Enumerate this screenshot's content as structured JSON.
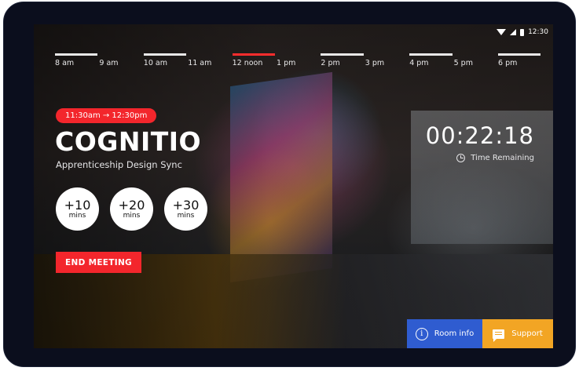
{
  "status_bar": {
    "time": "12:30"
  },
  "timeline": {
    "labels": [
      "8 am",
      "9 am",
      "10 am",
      "11 am",
      "12 noon",
      "1 pm",
      "2 pm",
      "3 pm",
      "4 pm",
      "5 pm",
      "6 pm"
    ],
    "active_hour": "12 noon"
  },
  "meeting": {
    "time_range": "11:30am → 12:30pm",
    "room_name": "COGNITIO",
    "title": "Apprenticeship Design Sync"
  },
  "extend_buttons": [
    {
      "value": "+10",
      "unit": "mins"
    },
    {
      "value": "+20",
      "unit": "mins"
    },
    {
      "value": "+30",
      "unit": "mins"
    }
  ],
  "end_meeting_label": "END MEETING",
  "countdown": {
    "value": "00:22:18",
    "label": "Time Remaining"
  },
  "bottom": {
    "room_info_label": "Room info",
    "support_label": "Support"
  },
  "colors": {
    "accent_red": "#f3262c",
    "room_info_blue": "#2f5cd0",
    "support_orange": "#f2a524"
  },
  "icons": [
    "wifi-icon",
    "signal-icon",
    "battery-icon",
    "clock-icon",
    "info-icon",
    "chat-icon"
  ]
}
